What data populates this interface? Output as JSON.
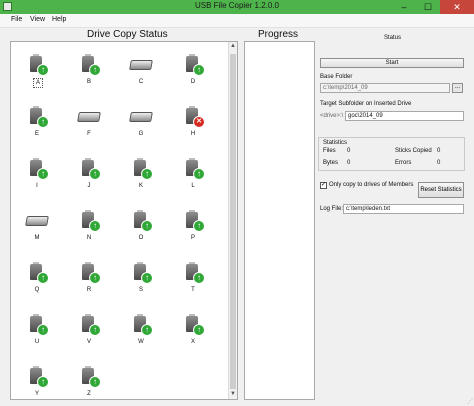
{
  "window": {
    "title": "USB File Copier 1.2.0.0",
    "minimize": "–",
    "maximize": "☐",
    "close": "✕"
  },
  "menu": [
    "File",
    "View",
    "Help"
  ],
  "drive_copy_status": {
    "title": "Drive Copy Status",
    "drives": [
      {
        "label": "A",
        "type": "usb",
        "status": "ok"
      },
      {
        "label": "B",
        "type": "usb",
        "status": "ok"
      },
      {
        "label": "C",
        "type": "hdd",
        "status": "none"
      },
      {
        "label": "D",
        "type": "usb",
        "status": "ok"
      },
      {
        "label": "E",
        "type": "usb",
        "status": "ok"
      },
      {
        "label": "F",
        "type": "hdd",
        "status": "none"
      },
      {
        "label": "G",
        "type": "hdd",
        "status": "none"
      },
      {
        "label": "H",
        "type": "usb",
        "status": "error"
      },
      {
        "label": "I",
        "type": "usb",
        "status": "ok"
      },
      {
        "label": "J",
        "type": "usb",
        "status": "ok"
      },
      {
        "label": "K",
        "type": "usb",
        "status": "ok"
      },
      {
        "label": "L",
        "type": "usb",
        "status": "ok"
      },
      {
        "label": "M",
        "type": "hdd",
        "status": "none"
      },
      {
        "label": "N",
        "type": "usb",
        "status": "ok"
      },
      {
        "label": "O",
        "type": "usb",
        "status": "ok"
      },
      {
        "label": "P",
        "type": "usb",
        "status": "ok"
      },
      {
        "label": "Q",
        "type": "usb",
        "status": "ok"
      },
      {
        "label": "R",
        "type": "usb",
        "status": "ok"
      },
      {
        "label": "S",
        "type": "usb",
        "status": "ok"
      },
      {
        "label": "T",
        "type": "usb",
        "status": "ok"
      },
      {
        "label": "U",
        "type": "usb",
        "status": "ok"
      },
      {
        "label": "V",
        "type": "usb",
        "status": "ok"
      },
      {
        "label": "W",
        "type": "usb",
        "status": "ok"
      },
      {
        "label": "X",
        "type": "usb",
        "status": "ok"
      },
      {
        "label": "Y",
        "type": "usb",
        "status": "ok"
      },
      {
        "label": "Z",
        "type": "usb",
        "status": "ok"
      }
    ]
  },
  "progress": {
    "title": "Progress"
  },
  "status": {
    "label": "Status",
    "start_button": "Start",
    "base_folder_label": "Base Folder",
    "base_folder_value": "c:\\temp\\2014_09",
    "browse_button": "...",
    "target_label": "Target Subfolder on Inserted Drive",
    "target_prefix": "<drive>:\\",
    "target_value": "goc\\2014_09",
    "statistics": {
      "title": "Statistics",
      "files_label": "Files",
      "files_value": "0",
      "sticks_label": "Sticks Copied",
      "sticks_value": "0",
      "bytes_label": "Bytes",
      "bytes_value": "0",
      "errors_label": "Errors",
      "errors_value": "0"
    },
    "members_checkbox_label": "Only copy to drives of Members",
    "members_checked": true,
    "reset_button": "Reset Statistics",
    "log_file_label": "Log File:",
    "log_file_value": "c:\\temp\\leden.txt"
  },
  "colors": {
    "titlebar": "#4fb34c",
    "ok_badge": "#2fa836",
    "error_badge": "#d62b22",
    "close_button": "#c7463b"
  }
}
